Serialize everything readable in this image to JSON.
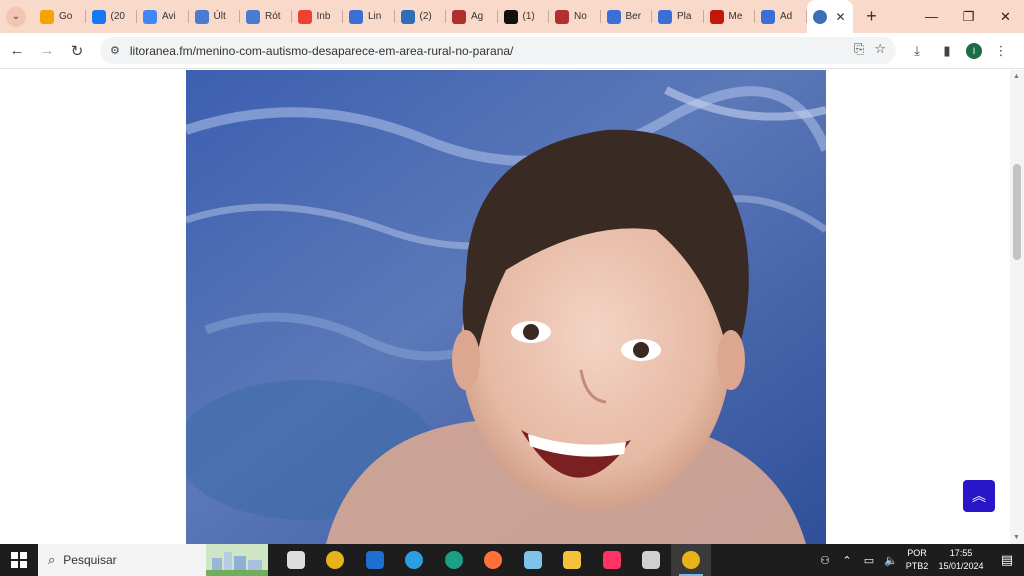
{
  "browser": {
    "tabs": [
      {
        "label": "Go",
        "favicon": "analytics-icon",
        "color": "#f4a300"
      },
      {
        "label": "(20",
        "favicon": "facebook-icon",
        "color": "#1877f2"
      },
      {
        "label": "Avi",
        "favicon": "docs-icon",
        "color": "#4285f4"
      },
      {
        "label": "Últ",
        "favicon": "rss-icon",
        "color": "#4a7bd0"
      },
      {
        "label": "Rót",
        "favicon": "rss-icon",
        "color": "#4a7bd0"
      },
      {
        "label": "Inb",
        "favicon": "gmail-icon",
        "color": "#ea4335"
      },
      {
        "label": "Lin",
        "favicon": "bp-icon",
        "color": "#3b6fd6"
      },
      {
        "label": "(2)",
        "favicon": "cloud-icon",
        "color": "#2f6db5"
      },
      {
        "label": "Ag",
        "favicon": "shield-icon",
        "color": "#b03030"
      },
      {
        "label": "(1)",
        "favicon": "x-icon",
        "color": "#111111"
      },
      {
        "label": "No",
        "favicon": "shield-icon",
        "color": "#b03030"
      },
      {
        "label": "Ber",
        "favicon": "bp-icon",
        "color": "#3b6fd6"
      },
      {
        "label": "Pla",
        "favicon": "bp-icon",
        "color": "#3b6fd6"
      },
      {
        "label": "Me",
        "favicon": "g1-icon",
        "color": "#c4170c"
      },
      {
        "label": "Ad",
        "favicon": "bp-icon",
        "color": "#3b6fd6"
      }
    ],
    "active_tab_favicon": "globe-icon",
    "url": "litoranea.fm/menino-com-autismo-desaparece-em-area-rural-no-parana/",
    "profile_initial": "I"
  },
  "taskbar": {
    "search_placeholder": "Pesquisar",
    "apps": [
      {
        "name": "task-view-icon",
        "color": "#dddddd"
      },
      {
        "name": "chrome-icon",
        "color": "#e8b21a"
      },
      {
        "name": "mail-icon",
        "color": "#1f6fd1"
      },
      {
        "name": "ie-icon",
        "color": "#2d9ee0"
      },
      {
        "name": "edge-icon",
        "color": "#1aa088"
      },
      {
        "name": "firefox-icon",
        "color": "#ff7139"
      },
      {
        "name": "notepad-icon",
        "color": "#7fc3e8"
      },
      {
        "name": "file-explorer-icon",
        "color": "#f3c13a"
      },
      {
        "name": "indesign-icon",
        "color": "#ff3366"
      },
      {
        "name": "paint-icon",
        "color": "#d0d0d0"
      },
      {
        "name": "chrome-profile-icon",
        "color": "#e8b21a"
      }
    ],
    "lang_line1": "POR",
    "lang_line2": "PTB2",
    "time": "17:55",
    "date": "15/01/2024"
  }
}
